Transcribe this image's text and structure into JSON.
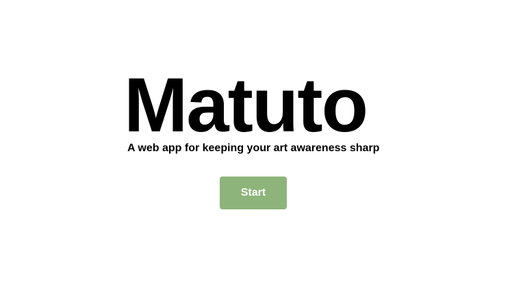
{
  "hero": {
    "title": "Matuto",
    "tagline": "A web app for keeping your art awareness sharp",
    "start_label": "Start"
  },
  "colors": {
    "background": "#ffffff",
    "text": "#000000",
    "button_background": "#8db47a",
    "button_text": "#ffffff"
  }
}
